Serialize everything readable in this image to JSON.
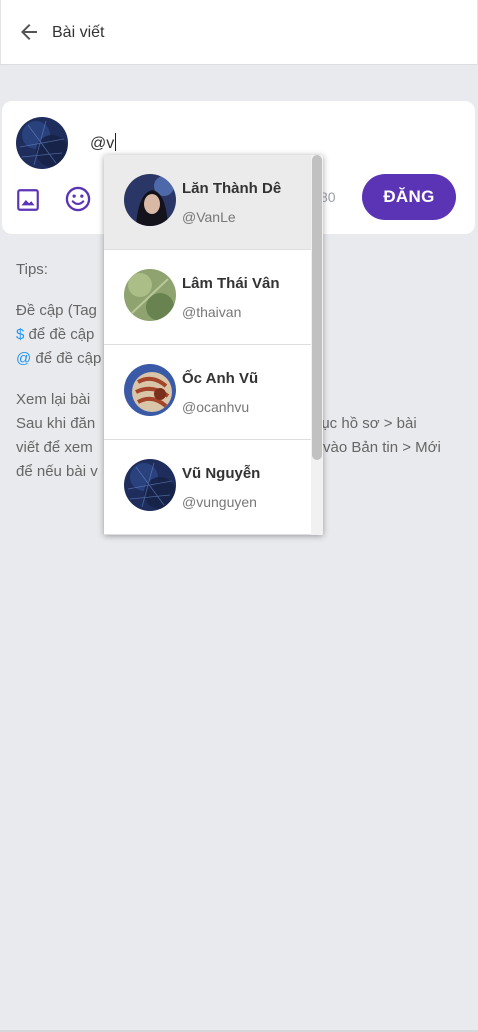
{
  "header": {
    "back_icon": "arrow-left-icon",
    "title": "Bài viết"
  },
  "composer": {
    "input_value": "@v",
    "char_count": "80",
    "post_label": "ĐĂNG",
    "accent_color": "#5b34b5",
    "image_icon": "image-icon",
    "emoji_icon": "smile-icon"
  },
  "tips": {
    "heading": "Tips:",
    "mention_title": "Đề cập (Tag",
    "dollar_symbol": "$",
    "dollar_text": " để đề cập",
    "at_symbol": "@",
    "at_text": " để đề cập",
    "review_title": "Xem lại bài",
    "review_line1_a": "Sau khi đăn",
    "review_line1_b": "nục hồ sơ > bài",
    "review_line2_a": "viết để xem",
    "review_line2_b": "vào Bản tin > Mới",
    "review_line3": "để nếu bài v",
    "link_color": "#2196f3"
  },
  "mentions": [
    {
      "name": "Lăn Thành Dê",
      "handle": "@VanLe"
    },
    {
      "name": "Lâm Thái Vân",
      "handle": "@thaivan"
    },
    {
      "name": "Ốc Anh Vũ",
      "handle": "@ocanhvu"
    },
    {
      "name": "Vũ Nguyễn",
      "handle": "@vunguyen"
    }
  ]
}
